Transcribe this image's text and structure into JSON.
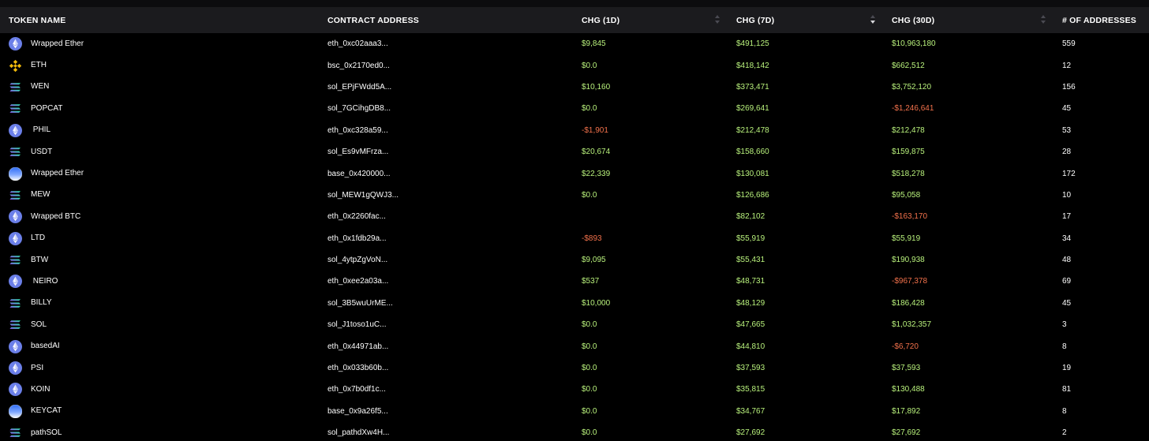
{
  "headers": {
    "name": "TOKEN NAME",
    "address": "CONTRACT ADDRESS",
    "chg_1d": "CHG (1D)",
    "chg_7d": "CHG (7D)",
    "chg_30d": "CHG (30D)",
    "num_addresses": "# OF ADDRESSES"
  },
  "colors": {
    "positive": "#b9f27c",
    "negative": "#f2714b",
    "header_bg": "#1b1b1e",
    "background": "#000000"
  },
  "icons": {
    "eth": "ethereum-icon",
    "bsc": "bnb-chain-icon",
    "sol": "solana-icon",
    "base": "base-icon"
  },
  "rows": [
    {
      "chain": "eth",
      "name": "Wrapped Ether",
      "address": "eth_0xc02aaa3...",
      "chg_1d": "$9,845",
      "chg_7d": "$491,125",
      "chg_30d": "$10,963,180",
      "count": "559"
    },
    {
      "chain": "bsc",
      "name": "ETH",
      "address": "bsc_0x2170ed0...",
      "chg_1d": "$0.0",
      "chg_7d": "$418,142",
      "chg_30d": "$662,512",
      "count": "12"
    },
    {
      "chain": "sol",
      "name": "WEN",
      "address": "sol_EPjFWdd5A...",
      "chg_1d": "$10,160",
      "chg_7d": "$373,471",
      "chg_30d": "$3,752,120",
      "count": "156"
    },
    {
      "chain": "sol",
      "name": "POPCAT",
      "address": "sol_7GCihgDB8...",
      "chg_1d": "$0.0",
      "chg_7d": "$269,641",
      "chg_30d": "-$1,246,641",
      "count": "45"
    },
    {
      "chain": "eth",
      "name": " PHIL",
      "address": "eth_0xc328a59...",
      "chg_1d": "-$1,901",
      "chg_7d": "$212,478",
      "chg_30d": "$212,478",
      "count": "53"
    },
    {
      "chain": "sol",
      "name": "USDT",
      "address": "sol_Es9vMFrza...",
      "chg_1d": "$20,674",
      "chg_7d": "$158,660",
      "chg_30d": "$159,875",
      "count": "28"
    },
    {
      "chain": "base",
      "name": "Wrapped Ether",
      "address": "base_0x420000...",
      "chg_1d": "$22,339",
      "chg_7d": "$130,081",
      "chg_30d": "$518,278",
      "count": "172"
    },
    {
      "chain": "sol",
      "name": "MEW",
      "address": "sol_MEW1gQWJ3...",
      "chg_1d": "$0.0",
      "chg_7d": "$126,686",
      "chg_30d": "$95,058",
      "count": "10"
    },
    {
      "chain": "eth",
      "name": "Wrapped BTC",
      "address": "eth_0x2260fac...",
      "chg_1d": "",
      "chg_7d": "$82,102",
      "chg_30d": "-$163,170",
      "count": "17"
    },
    {
      "chain": "eth",
      "name": "LTD",
      "address": "eth_0x1fdb29a...",
      "chg_1d": "-$893",
      "chg_7d": "$55,919",
      "chg_30d": "$55,919",
      "count": "34"
    },
    {
      "chain": "sol",
      "name": "BTW",
      "address": "sol_4ytpZgVoN...",
      "chg_1d": "$9,095",
      "chg_7d": "$55,431",
      "chg_30d": "$190,938",
      "count": "48"
    },
    {
      "chain": "eth",
      "name": " NEIRO",
      "address": "eth_0xee2a03a...",
      "chg_1d": "$537",
      "chg_7d": "$48,731",
      "chg_30d": "-$967,378",
      "count": "69"
    },
    {
      "chain": "sol",
      "name": "BILLY",
      "address": "sol_3B5wuUrME...",
      "chg_1d": "$10,000",
      "chg_7d": "$48,129",
      "chg_30d": "$186,428",
      "count": "45"
    },
    {
      "chain": "sol",
      "name": "SOL",
      "address": "sol_J1toso1uC...",
      "chg_1d": "$0.0",
      "chg_7d": "$47,665",
      "chg_30d": "$1,032,357",
      "count": "3"
    },
    {
      "chain": "eth",
      "name": "basedAI",
      "address": "eth_0x44971ab...",
      "chg_1d": "$0.0",
      "chg_7d": "$44,810",
      "chg_30d": "-$6,720",
      "count": "8"
    },
    {
      "chain": "eth",
      "name": "PSI",
      "address": "eth_0x033b60b...",
      "chg_1d": "$0.0",
      "chg_7d": "$37,593",
      "chg_30d": "$37,593",
      "count": "19"
    },
    {
      "chain": "eth",
      "name": "KOIN",
      "address": "eth_0x7b0df1c...",
      "chg_1d": "$0.0",
      "chg_7d": "$35,815",
      "chg_30d": "$130,488",
      "count": "81"
    },
    {
      "chain": "base",
      "name": "KEYCAT",
      "address": "base_0x9a26f5...",
      "chg_1d": "$0.0",
      "chg_7d": "$34,767",
      "chg_30d": "$17,892",
      "count": "8"
    },
    {
      "chain": "sol",
      "name": "pathSOL",
      "address": "sol_pathdXw4H...",
      "chg_1d": "$0.0",
      "chg_7d": "$27,692",
      "chg_30d": "$27,692",
      "count": "2"
    }
  ]
}
